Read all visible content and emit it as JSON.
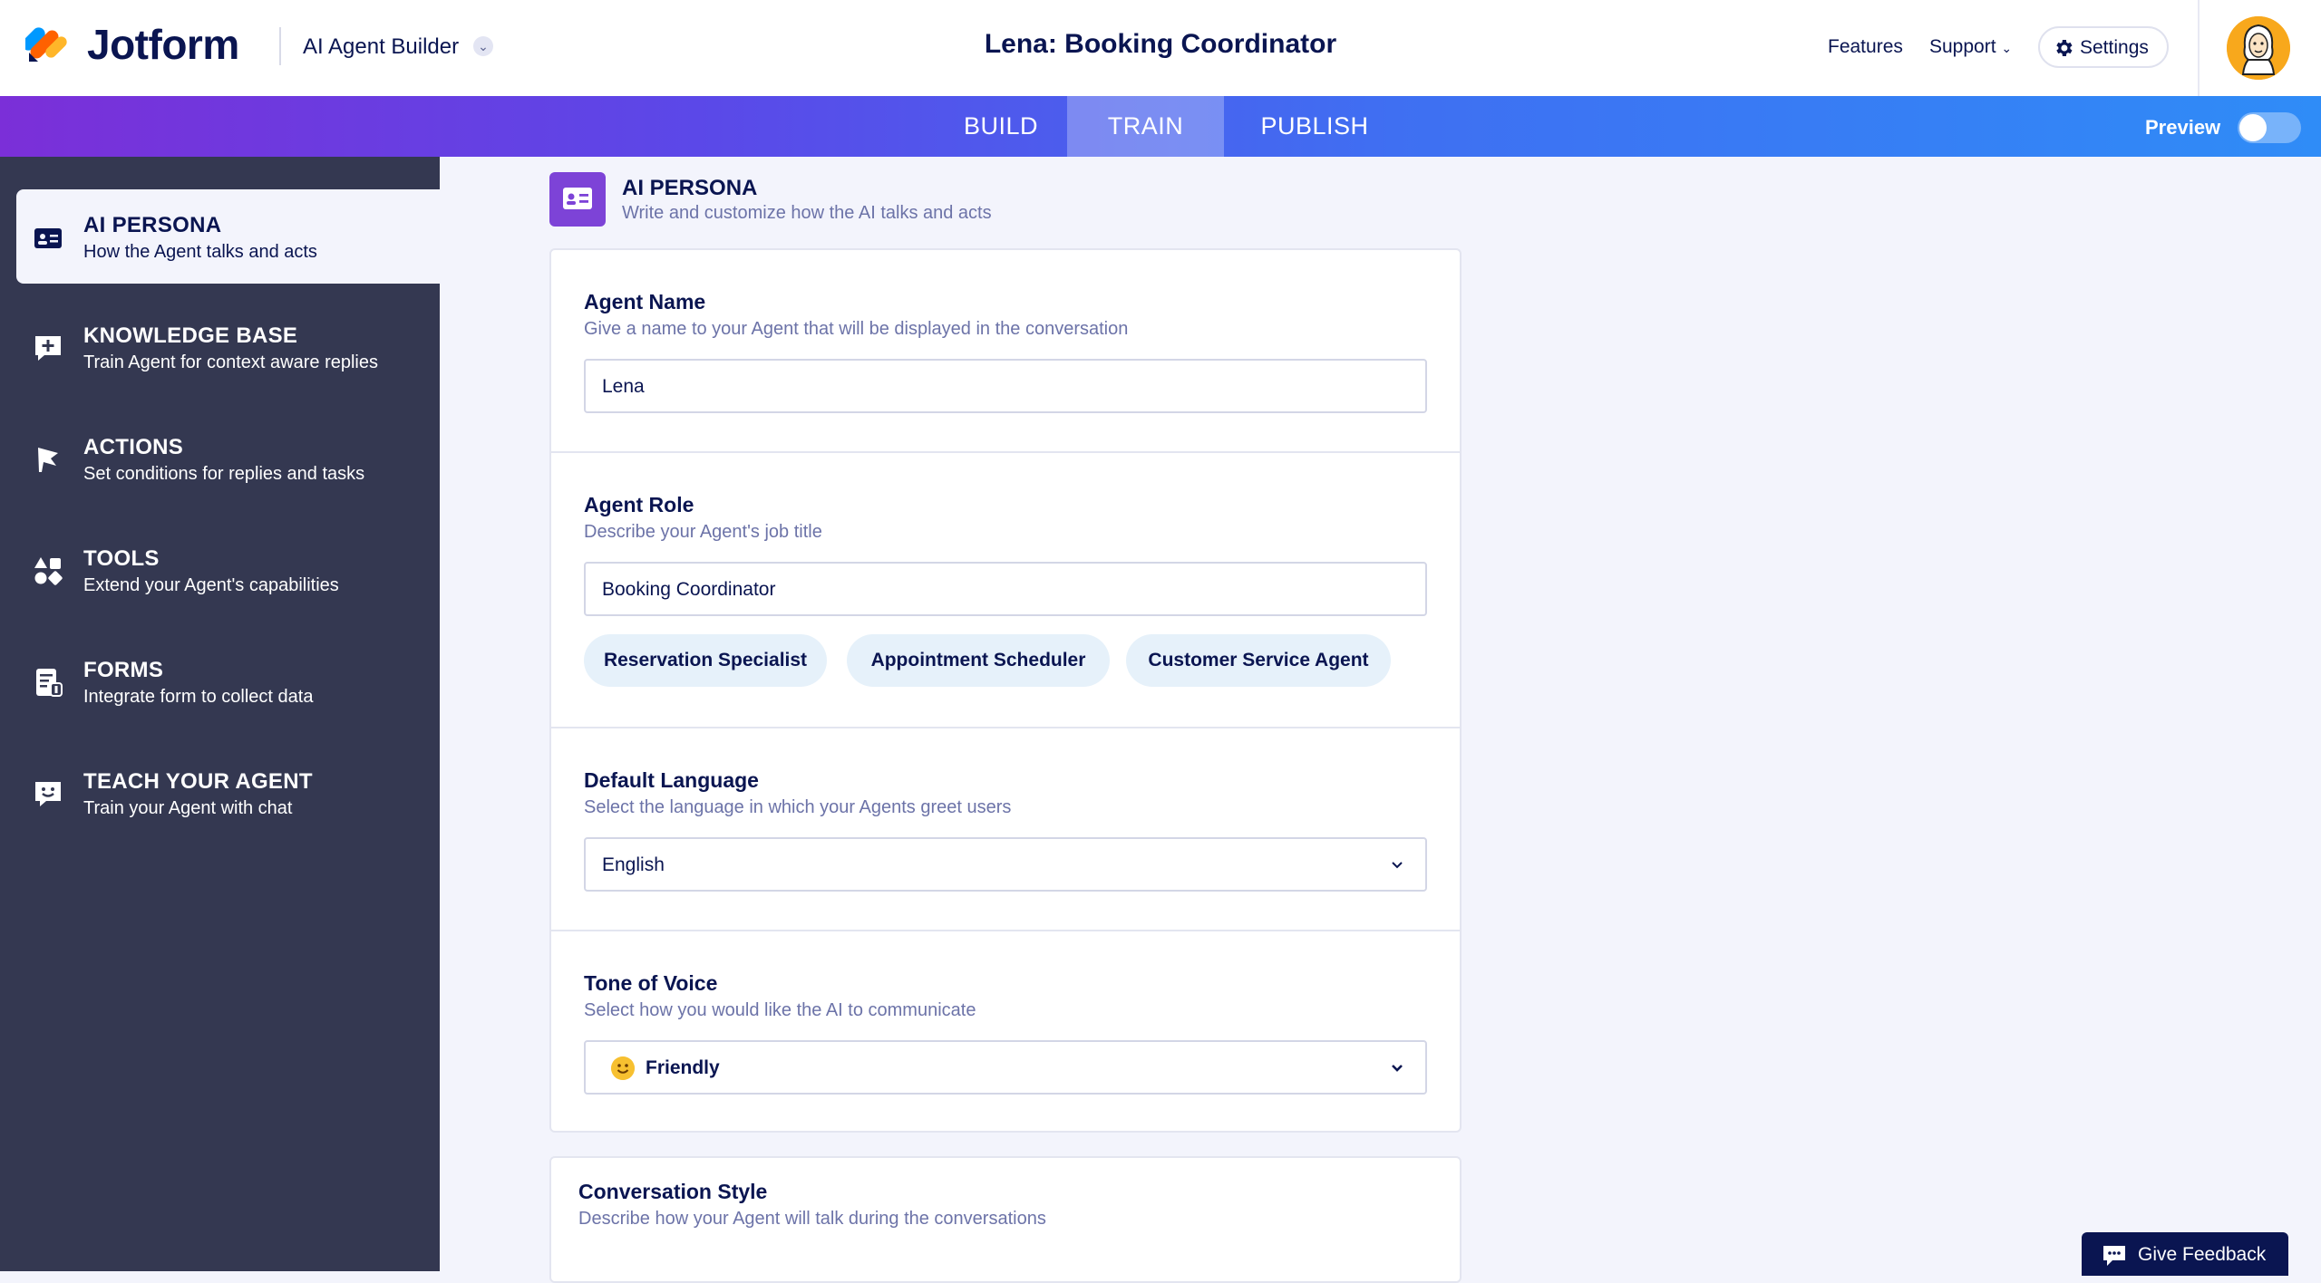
{
  "header": {
    "brand": "Jotform",
    "product": "AI Agent Builder",
    "title": "Lena: Booking Coordinator",
    "nav": {
      "features": "Features",
      "support": "Support",
      "settings": "Settings"
    }
  },
  "tabs": {
    "build": "BUILD",
    "train": "TRAIN",
    "publish": "PUBLISH",
    "active": "TRAIN"
  },
  "preview": {
    "label": "Preview",
    "enabled": false
  },
  "sidebar": {
    "items": [
      {
        "title": "AI PERSONA",
        "subtitle": "How the Agent talks and acts",
        "icon": "id-card-icon",
        "active": true
      },
      {
        "title": "KNOWLEDGE BASE",
        "subtitle": "Train Agent for context aware replies",
        "icon": "knowledge-plus-icon"
      },
      {
        "title": "ACTIONS",
        "subtitle": "Set conditions for replies and tasks",
        "icon": "flag-icon"
      },
      {
        "title": "TOOLS",
        "subtitle": "Extend your Agent's capabilities",
        "icon": "shapes-icon"
      },
      {
        "title": "FORMS",
        "subtitle": "Integrate form to collect data",
        "icon": "form-icon"
      },
      {
        "title": "TEACH YOUR AGENT",
        "subtitle": "Train your Agent with chat",
        "icon": "chat-smile-icon"
      }
    ]
  },
  "section": {
    "title": "AI PERSONA",
    "subtitle": "Write and customize how the AI talks and acts"
  },
  "form": {
    "agent_name": {
      "label": "Agent Name",
      "hint": "Give a name to your Agent that will be displayed in the conversation",
      "value": "Lena"
    },
    "agent_role": {
      "label": "Agent Role",
      "hint": "Describe your Agent's job title",
      "value": "Booking Coordinator",
      "suggestions": [
        "Reservation Specialist",
        "Appointment Scheduler",
        "Customer Service Agent"
      ]
    },
    "default_language": {
      "label": "Default Language",
      "hint": "Select the language in which your Agents greet users",
      "value": "English"
    },
    "tone_of_voice": {
      "label": "Tone of Voice",
      "hint": "Select how you would like the AI to communicate",
      "value": "Friendly",
      "icon": "smile-emoji-icon"
    },
    "conversation_style": {
      "label": "Conversation Style",
      "hint": "Describe how your Agent will talk during the conversations"
    }
  },
  "feedback": {
    "label": "Give Feedback"
  },
  "colors": {
    "accent_purple": "#7d43d7",
    "sidebar_bg": "#343851",
    "navy": "#0a1551",
    "chip_bg": "#e6f1fa"
  }
}
